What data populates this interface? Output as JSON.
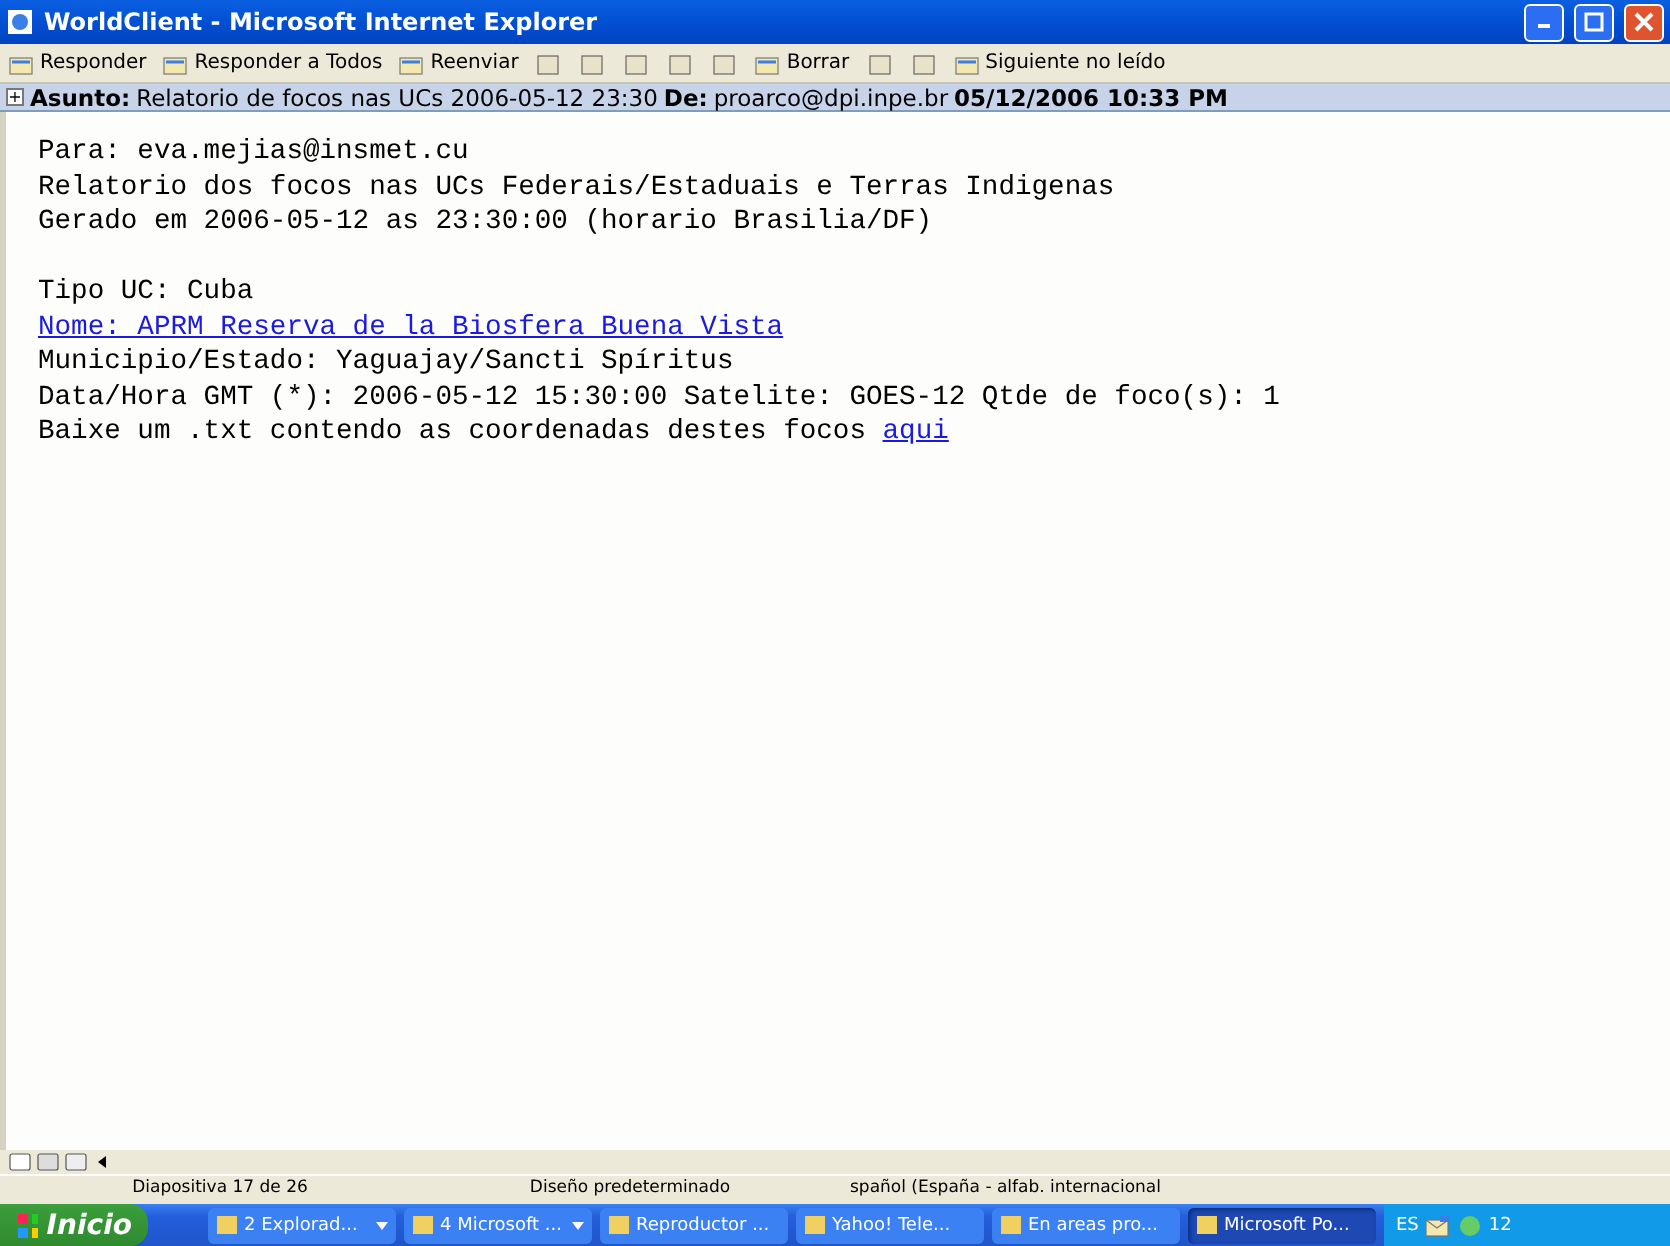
{
  "window": {
    "title": "WorldClient - Microsoft Internet Explorer"
  },
  "toolbar": [
    {
      "kind": "labeled",
      "label": "Responder"
    },
    {
      "kind": "labeled",
      "label": "Responder a Todos"
    },
    {
      "kind": "labeled",
      "label": "Reenviar"
    },
    {
      "kind": "icon"
    },
    {
      "kind": "icon"
    },
    {
      "kind": "icon"
    },
    {
      "kind": "icon"
    },
    {
      "kind": "icon"
    },
    {
      "kind": "labeled",
      "label": "Borrar"
    },
    {
      "kind": "icon"
    },
    {
      "kind": "icon"
    },
    {
      "kind": "labeled",
      "label": "Siguiente no leído"
    }
  ],
  "header": {
    "expand": "+",
    "subject_label": "Asunto:",
    "subject": "Relatorio de focos nas UCs 2006-05-12 23:30",
    "from_label": "De:",
    "from": "proarco@dpi.inpe.br",
    "date": "05/12/2006 10:33 PM"
  },
  "body": [
    {
      "kind": "text",
      "text": "Para: eva.mejias@insmet.cu"
    },
    {
      "kind": "text",
      "text": "Relatorio dos focos nas UCs Federais/Estaduais e Terras Indigenas"
    },
    {
      "kind": "text",
      "text": "Gerado em 2006-05-12 as 23:30:00 (horario Brasilia/DF)"
    },
    {
      "kind": "blank"
    },
    {
      "kind": "text",
      "text": "Tipo UC: Cuba"
    },
    {
      "kind": "link",
      "text": "Nome: APRM Reserva de la Biosfera Buena Vista"
    },
    {
      "kind": "text",
      "text": "Municipio/Estado: Yaguajay/Sancti Spíritus"
    },
    {
      "kind": "text",
      "text": "Data/Hora GMT (*): 2006-05-12 15:30:00 Satelite: GOES-12 Qtde de foco(s): 1"
    },
    {
      "kind": "with_link",
      "text": "Baixe um .txt contendo as coordenadas destes focos",
      "link": "aqui"
    }
  ],
  "status_bar": [
    "Diapositiva 17 de 26",
    "Diseño predeterminado",
    "spañol (España - alfab. internacional"
  ],
  "taskbar": {
    "start": "Inicio",
    "items": [
      {
        "label": "2 Explorad...",
        "group": true,
        "selected": false
      },
      {
        "label": "4 Microsoft ...",
        "group": true,
        "selected": false
      },
      {
        "label": "Reproductor ...",
        "group": false,
        "selected": false
      },
      {
        "label": "Yahoo! Tele...",
        "group": false,
        "selected": false
      },
      {
        "label": "En areas pro...",
        "group": false,
        "selected": false
      },
      {
        "label": "Microsoft Po...",
        "group": false,
        "selected": true
      }
    ],
    "language": "ES",
    "clock": "12"
  }
}
